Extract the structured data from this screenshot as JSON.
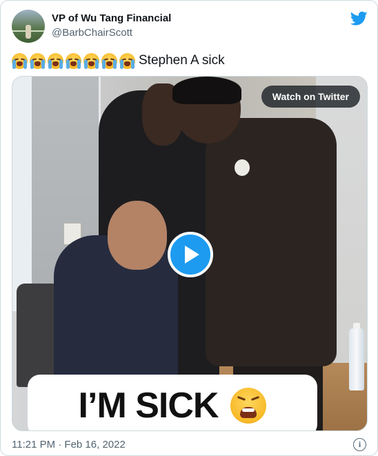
{
  "author": {
    "display_name": "VP of Wu Tang Financial",
    "handle": "@BarbChairScott",
    "avatar": "avatar-photo"
  },
  "brand": {
    "icon": "twitter-bird-icon",
    "color": "#1d9bf0"
  },
  "tweet": {
    "emoji_icon": "loudly-crying-face-icon",
    "emoji_count": 7,
    "text": "Stephen A sick"
  },
  "media": {
    "watch_label": "Watch on Twitter",
    "play_icon": "play-icon",
    "caption_text": "I’M SICK",
    "caption_emoji": "weary-face-icon"
  },
  "footer": {
    "timestamp": "11:21 PM · Feb 16, 2022",
    "info_icon": "info-icon"
  },
  "colors": {
    "text": "#0f1419",
    "secondary": "#536471",
    "accent": "#1d9bf0",
    "border": "#cfd9de"
  }
}
